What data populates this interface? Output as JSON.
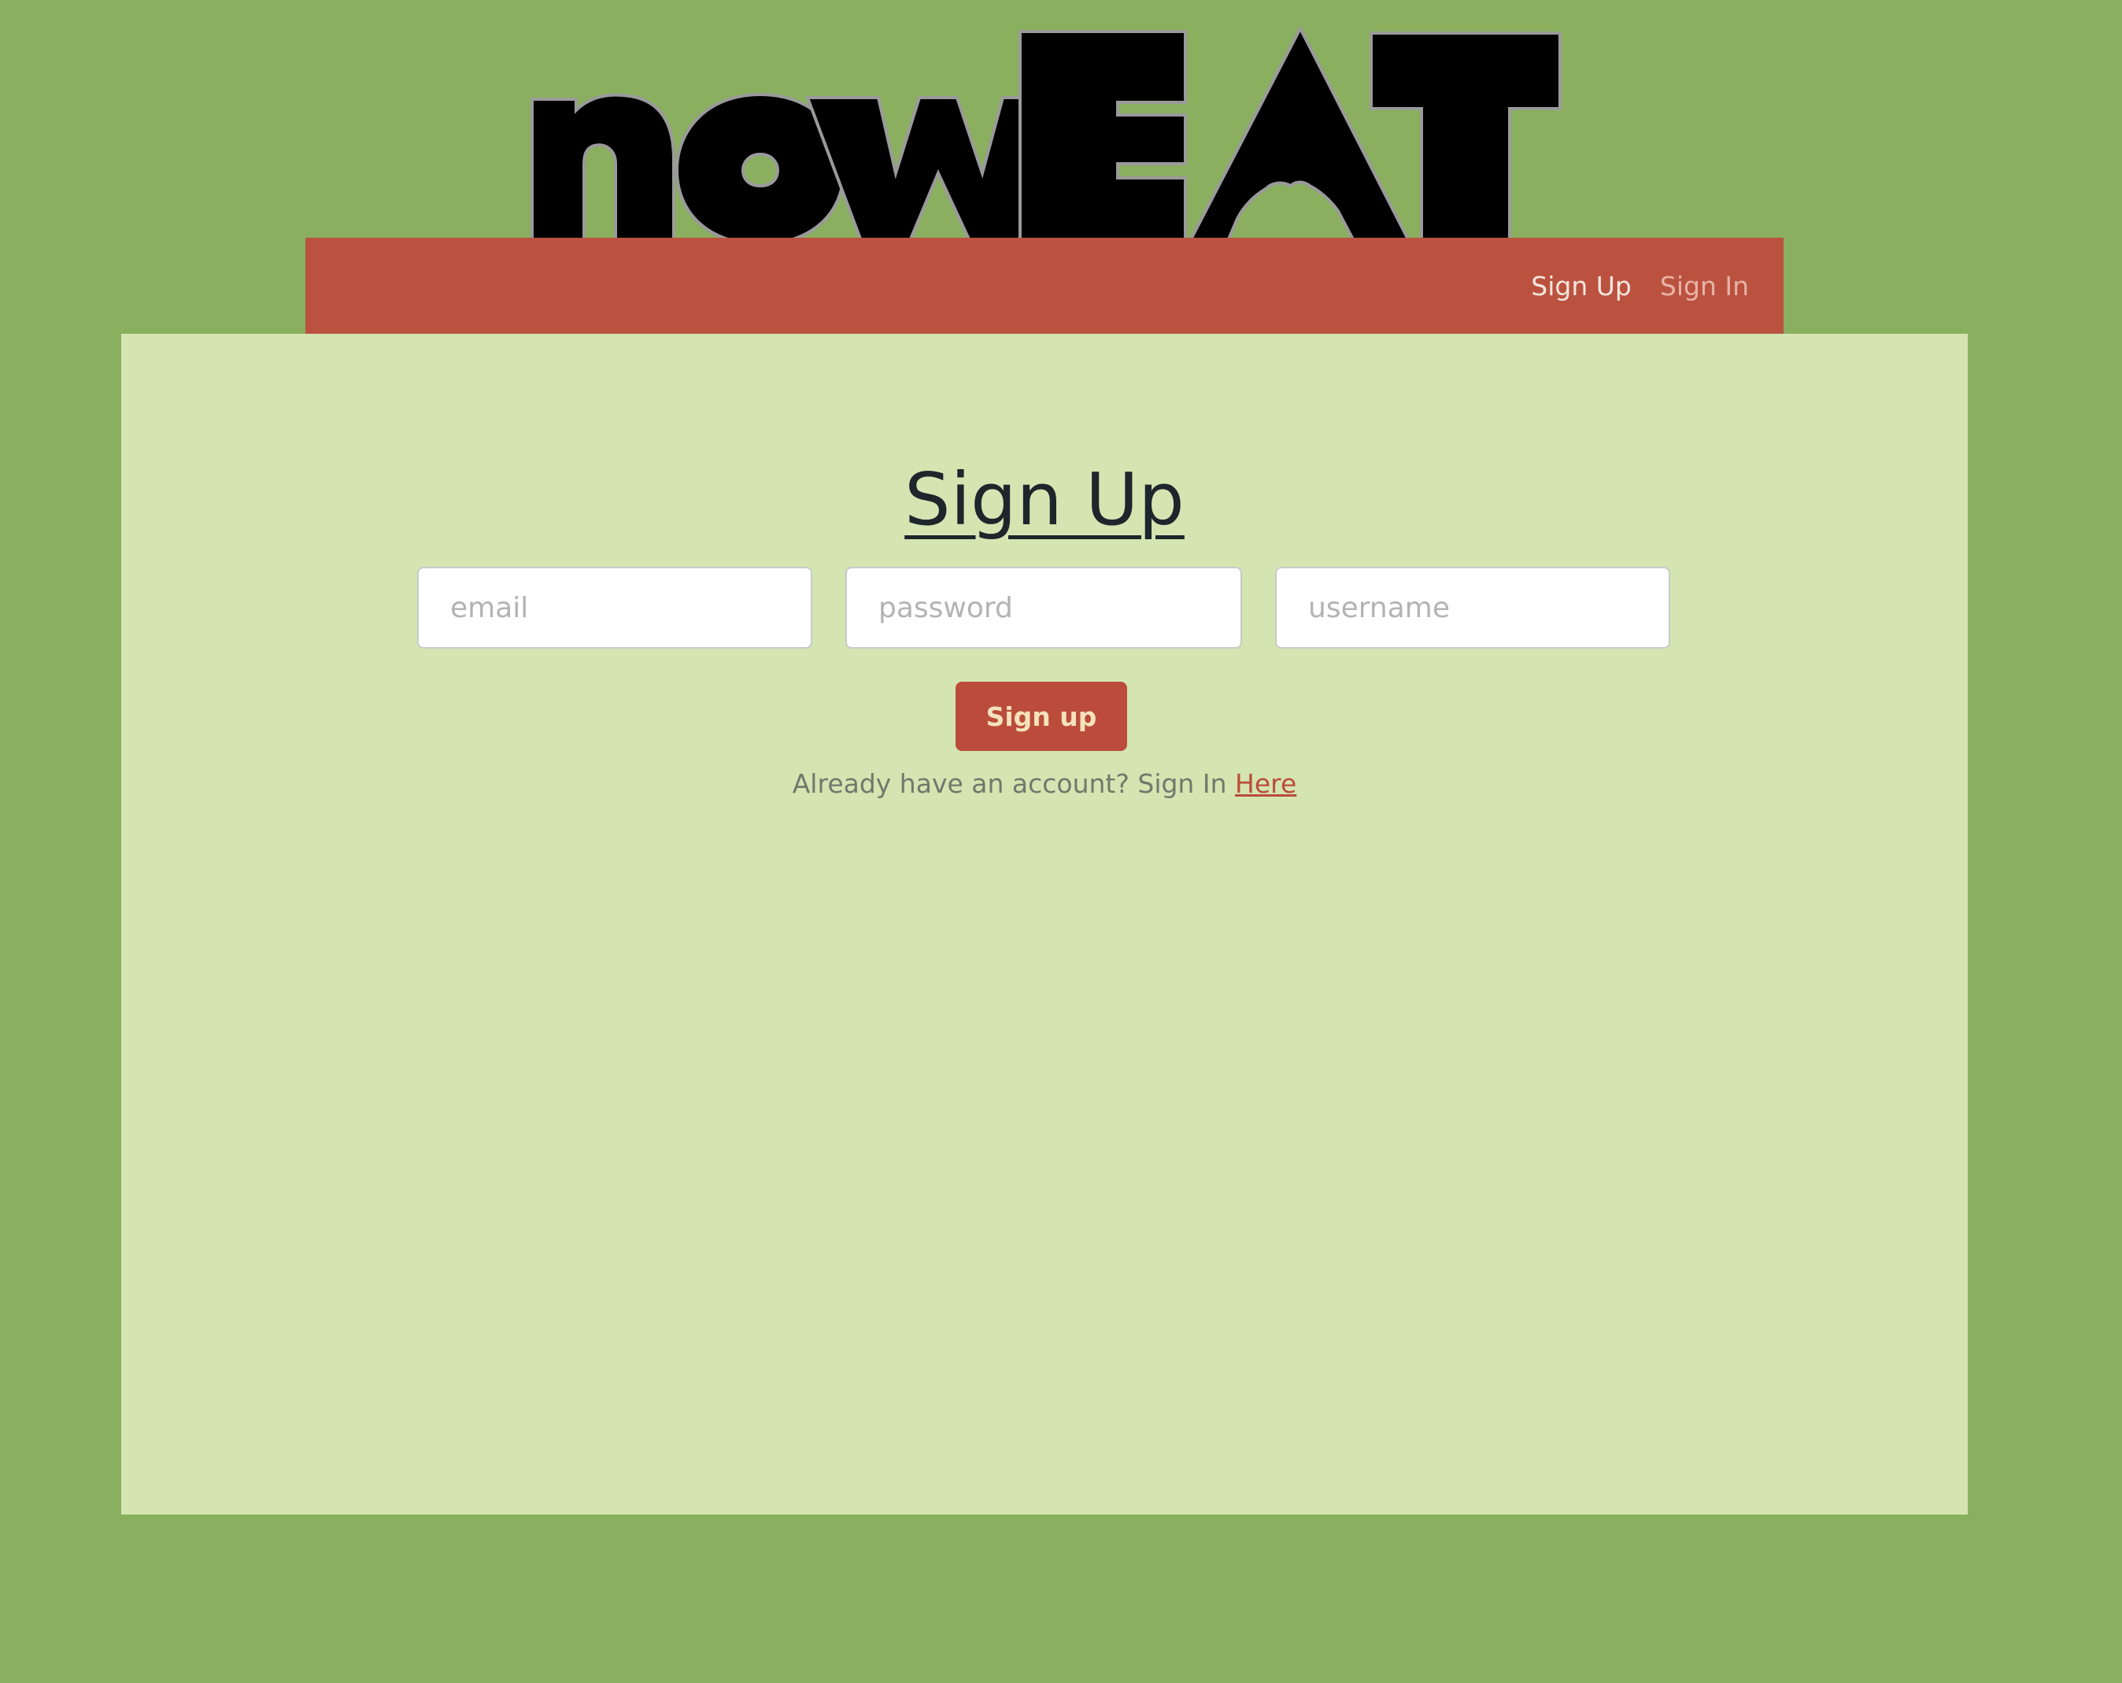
{
  "brand": {
    "logo_text": "nowEAT"
  },
  "nav": {
    "items": [
      {
        "label": "Sign Up"
      },
      {
        "label": "Sign In"
      }
    ]
  },
  "form": {
    "title": "Sign Up",
    "fields": {
      "email": {
        "placeholder": "email",
        "value": ""
      },
      "password": {
        "placeholder": "password",
        "value": ""
      },
      "username": {
        "placeholder": "username",
        "value": ""
      }
    },
    "submit_label": "Sign up",
    "signin_prompt": "Already have an account? Sign In",
    "signin_link": "Here"
  },
  "colors": {
    "page_background": "#8aaf5e",
    "navbar": "#bb5240",
    "panel": "#d4e5b2",
    "button": "#bb4c3b",
    "button_text": "#f4e2bc",
    "link": "#bb4c3b"
  }
}
